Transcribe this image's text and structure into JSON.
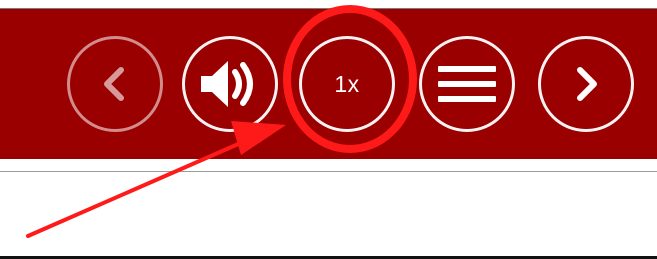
{
  "toolbar": {
    "background_color": "#9b0000",
    "controls": [
      {
        "name": "previous",
        "icon": "chevron-left-icon"
      },
      {
        "name": "audio",
        "icon": "speaker-icon"
      },
      {
        "name": "speed",
        "label": "1x"
      },
      {
        "name": "menu",
        "icon": "hamburger-menu-icon"
      },
      {
        "name": "next",
        "icon": "chevron-right-icon"
      }
    ]
  },
  "annotation": {
    "color": "#ff1a1a",
    "highlight": "speed-button",
    "arrow_icon": "arrow-icon",
    "circle_icon": "highlight-circle-icon"
  }
}
